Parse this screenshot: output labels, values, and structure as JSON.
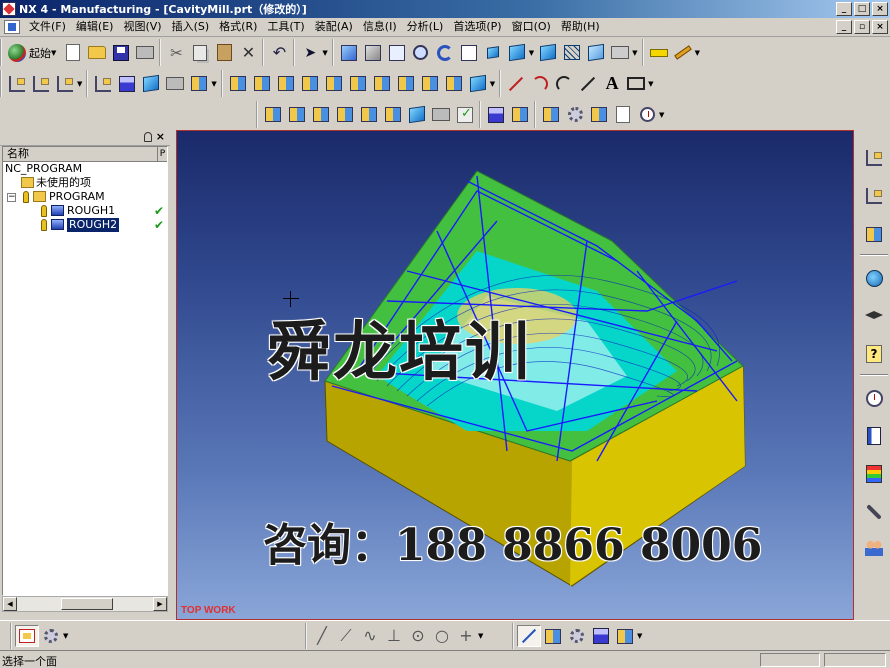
{
  "window": {
    "title": "NX 4 - Manufacturing - [CavityMill.prt（修改的）]"
  },
  "menu": {
    "items": [
      "文件(F)",
      "编辑(E)",
      "视图(V)",
      "插入(S)",
      "格式(R)",
      "工具(T)",
      "装配(A)",
      "信息(I)",
      "分析(L)",
      "首选项(P)",
      "窗口(O)",
      "帮助(H)"
    ]
  },
  "toolbar": {
    "start_label": "起始"
  },
  "navigator": {
    "column_name": "名称",
    "column_flag": "P",
    "tree": [
      {
        "label": "NC_PROGRAM",
        "level": 0
      },
      {
        "label": "未使用的项",
        "level": 1
      },
      {
        "label": "PROGRAM",
        "level": 1
      },
      {
        "label": "ROUGH1",
        "level": 2,
        "status": "ok"
      },
      {
        "label": "ROUGH2",
        "level": 2,
        "status": "ok",
        "selected": true
      }
    ]
  },
  "viewport": {
    "view_name": "TOP WORK",
    "overlay_title": "舜龙培训",
    "overlay_contact": "咨询：188 8866 8006",
    "colors": {
      "background_top": "#1a2a6a",
      "background_bottom": "#8aa6d8",
      "part_body": "#c8b400",
      "part_surface": "#3cc83c",
      "toolpath_cut": "#00e0e0",
      "toolpath_rapid": "#1a1aff"
    }
  },
  "status": {
    "prompt": "选择一个面"
  }
}
